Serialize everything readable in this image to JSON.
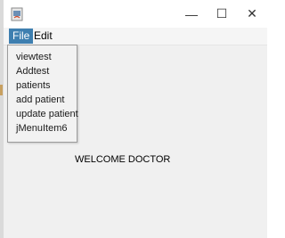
{
  "window": {
    "minimize_glyph": "—",
    "maximize_glyph": "☐",
    "close_glyph": "✕",
    "icon": "java-app-icon"
  },
  "menubar": {
    "file_label": "File",
    "edit_label": "Edit",
    "active_color": "#3e7fb0"
  },
  "file_menu": {
    "items": [
      "viewtest",
      "Addtest",
      "patients",
      "add patient",
      "update patient",
      "jMenuItem6"
    ]
  },
  "content": {
    "welcome_text": "WELCOME DOCTOR"
  }
}
